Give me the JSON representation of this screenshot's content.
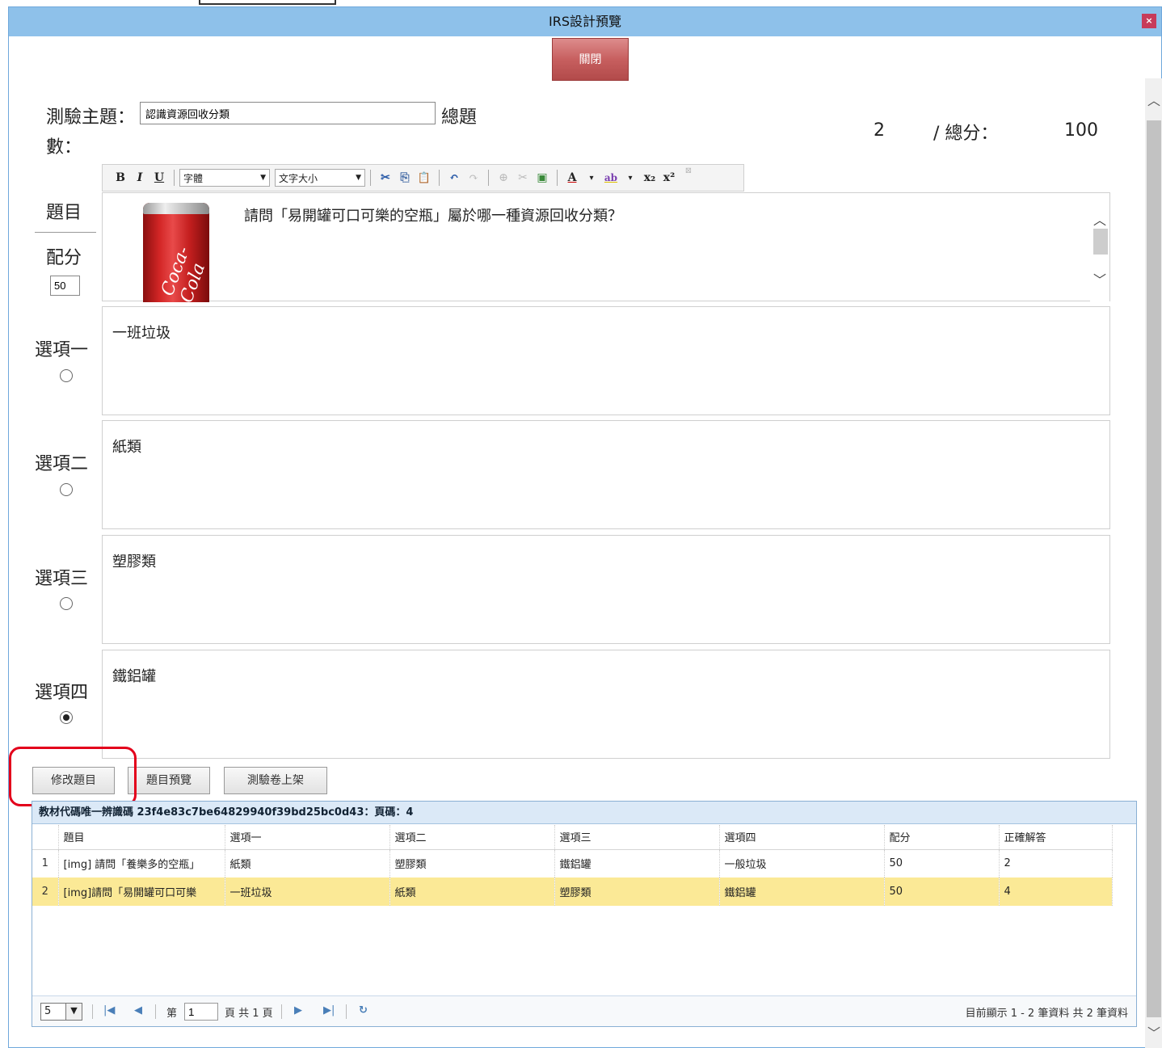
{
  "window": {
    "title": "IRS設計預覽",
    "close_x": "×"
  },
  "close_button": "關閉",
  "header": {
    "topic_label": "測驗主題：",
    "topic_value": "認識資源回收分類",
    "total_label_1": "總題",
    "total_label_2": "數：",
    "total_count": "2",
    "score_label": "/ 總分：",
    "total_score": "100"
  },
  "toolbar": {
    "bold": "B",
    "italic": "I",
    "underline": "U",
    "font": "字體",
    "size": "文字大小",
    "font_color": "A",
    "highlight": "ab",
    "subscript": "x₂",
    "superscript": "x²",
    "scissors": "✂",
    "copy": "⎘",
    "paste": "📋",
    "undo": "↶",
    "redo": "↷",
    "link": "⊕",
    "unlink": "✂",
    "image": "▣",
    "collapse": "⊠"
  },
  "question": {
    "label": "題目",
    "score_label": "配分",
    "score_value": "50",
    "text": "請問「易開罐可口可樂的空瓶」屬於哪一種資源回收分類？",
    "image_text": "Coca-Cola"
  },
  "options": [
    {
      "label": "選項一",
      "text": "一班垃圾",
      "selected": false
    },
    {
      "label": "選項二",
      "text": "紙類",
      "selected": false
    },
    {
      "label": "選項三",
      "text": "塑膠類",
      "selected": false
    },
    {
      "label": "選項四",
      "text": "鐵鋁罐",
      "selected": true
    }
  ],
  "buttons": {
    "edit": "修改題目",
    "preview": "題目預覽",
    "publish": "測驗卷上架"
  },
  "grid": {
    "caption": "教材代碼唯一辨識碼 23f4e83c7be64829940f39bd25bc0d43：頁碼：4",
    "columns": [
      "題目",
      "選項一",
      "選項二",
      "選項三",
      "選項四",
      "配分",
      "正確解答"
    ],
    "rows": [
      {
        "n": "1",
        "cells": [
          "[img] 請問「養樂多的空瓶」",
          "紙類",
          "塑膠類",
          "鐵鋁罐",
          "一般垃圾",
          "50",
          "2"
        ]
      },
      {
        "n": "2",
        "cells": [
          "[img]請問「易開罐可口可樂",
          "一班垃圾",
          "紙類",
          "塑膠類",
          "鐵鋁罐",
          "50",
          "4"
        ]
      }
    ],
    "pager": {
      "page_size": "5",
      "page_label_pre": "第",
      "page_value": "1",
      "page_label_post": "頁 共 1 頁",
      "status": "目前顯示 1 - 2 筆資料 共 2 筆資料",
      "first": "|◀",
      "prev": "◀",
      "next": "▶",
      "last": "▶|",
      "refresh": "↻",
      "dropdown_caret": "▼"
    }
  },
  "scroll": {
    "up": "︿",
    "down": "﹀"
  }
}
